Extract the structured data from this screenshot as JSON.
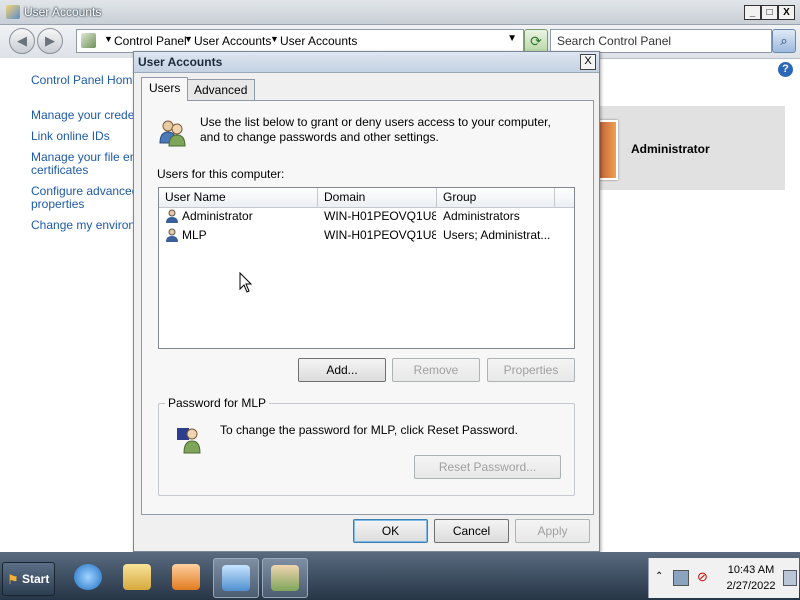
{
  "explorer": {
    "title": "User Accounts",
    "minimize": "_",
    "maximize": "□",
    "close": "X",
    "breadcrumbs": [
      "Control Panel",
      "User Accounts",
      "User Accounts"
    ],
    "search_placeholder": "Search Control Panel",
    "left_nav": [
      "Control Panel Home",
      "Manage your credentials",
      "Link online IDs",
      "Manage your file encryption",
      "certificates",
      "Configure advanced user profile",
      "properties",
      "Change my environment variables"
    ],
    "account_name": "Administrator"
  },
  "dialog": {
    "title": "User Accounts",
    "close": "X",
    "tabs": [
      {
        "label": "Users",
        "active": true
      },
      {
        "label": "Advanced",
        "active": false
      }
    ],
    "intro": "Use the list below to grant or deny users access to your computer, and to change passwords and other settings.",
    "users_label": "Users for this computer:",
    "columns": [
      "User Name",
      "Domain",
      "Group"
    ],
    "users": [
      {
        "name": "Administrator",
        "domain": "WIN-H01PEOVQ1U8",
        "group": "Administrators"
      },
      {
        "name": "MLP",
        "domain": "WIN-H01PEOVQ1U8",
        "group": "Users; Administrat..."
      }
    ],
    "buttons": {
      "add": "Add...",
      "remove": "Remove",
      "properties": "Properties",
      "reset_password": "Reset Password...",
      "ok": "OK",
      "cancel": "Cancel",
      "apply": "Apply"
    },
    "password_group_label": "Password for MLP",
    "password_text": "To change the password for MLP, click Reset Password."
  },
  "taskbar": {
    "start_label": "Start",
    "apps": [
      "internet-explorer",
      "windows-explorer",
      "media-player",
      "control-panel",
      "user-accounts"
    ],
    "time": "10:43 AM",
    "date": "2/27/2022"
  },
  "colors": {
    "link": "#1e5aa8",
    "taskbar": "#263647",
    "dialog_bg": "#f0f0f0"
  }
}
